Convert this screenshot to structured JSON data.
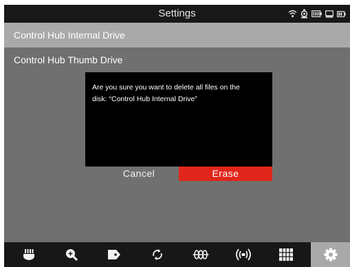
{
  "header": {
    "title": "Settings",
    "status_icons": [
      "wifi-icon",
      "camera-icon",
      "battery-icon",
      "storage-icon",
      "battery-small-icon"
    ]
  },
  "drives": [
    {
      "label": "Control Hub Internal Drive",
      "selected": true
    },
    {
      "label": "Control Hub Thumb Drive",
      "selected": false
    }
  ],
  "dialog": {
    "message_line1": "Are you sure you want to delete all files on the",
    "message_line2": "disk: “Control Hub Internal Drive”",
    "cancel_label": "Cancel",
    "erase_label": "Erase"
  },
  "bottom_nav": [
    {
      "icon": "connector-icon"
    },
    {
      "icon": "zoom-in-icon"
    },
    {
      "icon": "tag-icon"
    },
    {
      "icon": "sync-icon"
    },
    {
      "icon": "resistor-icon"
    },
    {
      "icon": "broadcast-icon"
    },
    {
      "icon": "grid-icon"
    },
    {
      "icon": "settings-icon",
      "active": true
    }
  ],
  "colors": {
    "background": "#707070",
    "title_bar": "#181818",
    "selected_row": "#a9a9a9",
    "dialog": "#000000",
    "erase": "#e0261b"
  }
}
